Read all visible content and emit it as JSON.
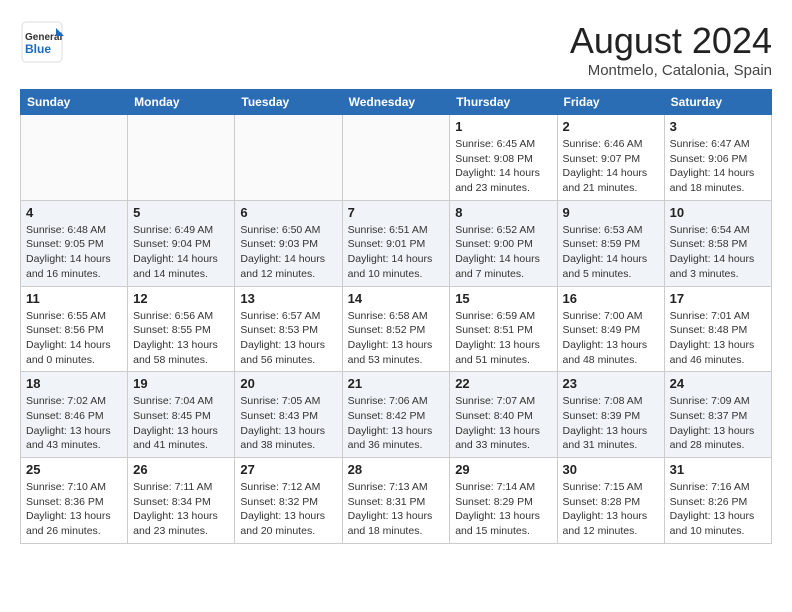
{
  "header": {
    "logo_general": "General",
    "logo_blue": "Blue",
    "month": "August 2024",
    "location": "Montmelo, Catalonia, Spain"
  },
  "days_of_week": [
    "Sunday",
    "Monday",
    "Tuesday",
    "Wednesday",
    "Thursday",
    "Friday",
    "Saturday"
  ],
  "weeks": [
    {
      "row_class": "row-1",
      "days": [
        {
          "num": "",
          "info": "",
          "empty": true
        },
        {
          "num": "",
          "info": "",
          "empty": true
        },
        {
          "num": "",
          "info": "",
          "empty": true
        },
        {
          "num": "",
          "info": "",
          "empty": true
        },
        {
          "num": "1",
          "info": "Sunrise: 6:45 AM\nSunset: 9:08 PM\nDaylight: 14 hours\nand 23 minutes.",
          "empty": false
        },
        {
          "num": "2",
          "info": "Sunrise: 6:46 AM\nSunset: 9:07 PM\nDaylight: 14 hours\nand 21 minutes.",
          "empty": false
        },
        {
          "num": "3",
          "info": "Sunrise: 6:47 AM\nSunset: 9:06 PM\nDaylight: 14 hours\nand 18 minutes.",
          "empty": false
        }
      ]
    },
    {
      "row_class": "row-2",
      "days": [
        {
          "num": "4",
          "info": "Sunrise: 6:48 AM\nSunset: 9:05 PM\nDaylight: 14 hours\nand 16 minutes.",
          "empty": false
        },
        {
          "num": "5",
          "info": "Sunrise: 6:49 AM\nSunset: 9:04 PM\nDaylight: 14 hours\nand 14 minutes.",
          "empty": false
        },
        {
          "num": "6",
          "info": "Sunrise: 6:50 AM\nSunset: 9:03 PM\nDaylight: 14 hours\nand 12 minutes.",
          "empty": false
        },
        {
          "num": "7",
          "info": "Sunrise: 6:51 AM\nSunset: 9:01 PM\nDaylight: 14 hours\nand 10 minutes.",
          "empty": false
        },
        {
          "num": "8",
          "info": "Sunrise: 6:52 AM\nSunset: 9:00 PM\nDaylight: 14 hours\nand 7 minutes.",
          "empty": false
        },
        {
          "num": "9",
          "info": "Sunrise: 6:53 AM\nSunset: 8:59 PM\nDaylight: 14 hours\nand 5 minutes.",
          "empty": false
        },
        {
          "num": "10",
          "info": "Sunrise: 6:54 AM\nSunset: 8:58 PM\nDaylight: 14 hours\nand 3 minutes.",
          "empty": false
        }
      ]
    },
    {
      "row_class": "row-3",
      "days": [
        {
          "num": "11",
          "info": "Sunrise: 6:55 AM\nSunset: 8:56 PM\nDaylight: 14 hours\nand 0 minutes.",
          "empty": false
        },
        {
          "num": "12",
          "info": "Sunrise: 6:56 AM\nSunset: 8:55 PM\nDaylight: 13 hours\nand 58 minutes.",
          "empty": false
        },
        {
          "num": "13",
          "info": "Sunrise: 6:57 AM\nSunset: 8:53 PM\nDaylight: 13 hours\nand 56 minutes.",
          "empty": false
        },
        {
          "num": "14",
          "info": "Sunrise: 6:58 AM\nSunset: 8:52 PM\nDaylight: 13 hours\nand 53 minutes.",
          "empty": false
        },
        {
          "num": "15",
          "info": "Sunrise: 6:59 AM\nSunset: 8:51 PM\nDaylight: 13 hours\nand 51 minutes.",
          "empty": false
        },
        {
          "num": "16",
          "info": "Sunrise: 7:00 AM\nSunset: 8:49 PM\nDaylight: 13 hours\nand 48 minutes.",
          "empty": false
        },
        {
          "num": "17",
          "info": "Sunrise: 7:01 AM\nSunset: 8:48 PM\nDaylight: 13 hours\nand 46 minutes.",
          "empty": false
        }
      ]
    },
    {
      "row_class": "row-4",
      "days": [
        {
          "num": "18",
          "info": "Sunrise: 7:02 AM\nSunset: 8:46 PM\nDaylight: 13 hours\nand 43 minutes.",
          "empty": false
        },
        {
          "num": "19",
          "info": "Sunrise: 7:04 AM\nSunset: 8:45 PM\nDaylight: 13 hours\nand 41 minutes.",
          "empty": false
        },
        {
          "num": "20",
          "info": "Sunrise: 7:05 AM\nSunset: 8:43 PM\nDaylight: 13 hours\nand 38 minutes.",
          "empty": false
        },
        {
          "num": "21",
          "info": "Sunrise: 7:06 AM\nSunset: 8:42 PM\nDaylight: 13 hours\nand 36 minutes.",
          "empty": false
        },
        {
          "num": "22",
          "info": "Sunrise: 7:07 AM\nSunset: 8:40 PM\nDaylight: 13 hours\nand 33 minutes.",
          "empty": false
        },
        {
          "num": "23",
          "info": "Sunrise: 7:08 AM\nSunset: 8:39 PM\nDaylight: 13 hours\nand 31 minutes.",
          "empty": false
        },
        {
          "num": "24",
          "info": "Sunrise: 7:09 AM\nSunset: 8:37 PM\nDaylight: 13 hours\nand 28 minutes.",
          "empty": false
        }
      ]
    },
    {
      "row_class": "row-5",
      "days": [
        {
          "num": "25",
          "info": "Sunrise: 7:10 AM\nSunset: 8:36 PM\nDaylight: 13 hours\nand 26 minutes.",
          "empty": false
        },
        {
          "num": "26",
          "info": "Sunrise: 7:11 AM\nSunset: 8:34 PM\nDaylight: 13 hours\nand 23 minutes.",
          "empty": false
        },
        {
          "num": "27",
          "info": "Sunrise: 7:12 AM\nSunset: 8:32 PM\nDaylight: 13 hours\nand 20 minutes.",
          "empty": false
        },
        {
          "num": "28",
          "info": "Sunrise: 7:13 AM\nSunset: 8:31 PM\nDaylight: 13 hours\nand 18 minutes.",
          "empty": false
        },
        {
          "num": "29",
          "info": "Sunrise: 7:14 AM\nSunset: 8:29 PM\nDaylight: 13 hours\nand 15 minutes.",
          "empty": false
        },
        {
          "num": "30",
          "info": "Sunrise: 7:15 AM\nSunset: 8:28 PM\nDaylight: 13 hours\nand 12 minutes.",
          "empty": false
        },
        {
          "num": "31",
          "info": "Sunrise: 7:16 AM\nSunset: 8:26 PM\nDaylight: 13 hours\nand 10 minutes.",
          "empty": false
        }
      ]
    }
  ]
}
